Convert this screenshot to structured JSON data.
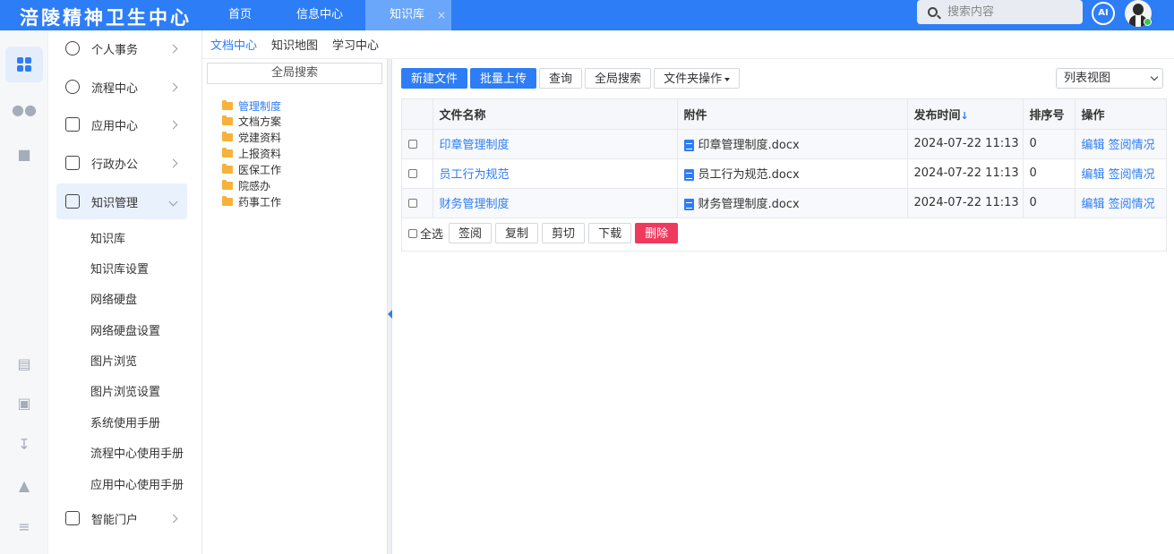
{
  "app": {
    "title": "涪陵精神卫生中心",
    "colors": {
      "primary": "#2d7df6",
      "danger": "#ef3a5d",
      "folder": "#f6b23a"
    }
  },
  "topnav": {
    "tabs": [
      {
        "label": "首页"
      },
      {
        "label": "信息中心"
      },
      {
        "label": "知识库",
        "active": true,
        "close": "×"
      }
    ]
  },
  "search": {
    "placeholder": "搜索内容"
  },
  "ai": {
    "label": "AI"
  },
  "rail": {
    "icons": [
      "apps-icon",
      "contacts-icon",
      "chat-icon",
      "chart-icon",
      "clipboard-icon",
      "download-icon",
      "shirt-icon",
      "collapse-icon"
    ]
  },
  "sidebar": {
    "items": [
      {
        "label": "个人事务",
        "icon": "person-icon"
      },
      {
        "label": "流程中心",
        "icon": "workflow-icon"
      },
      {
        "label": "应用中心",
        "icon": "bag-icon"
      },
      {
        "label": "行政办公",
        "icon": "briefcase-icon"
      },
      {
        "label": "知识管理",
        "icon": "book-icon",
        "active": true
      },
      {
        "label": "智能门户",
        "icon": "layout-icon"
      }
    ],
    "sub_items": [
      "知识库",
      "知识库设置",
      "网络硬盘",
      "网络硬盘设置",
      "图片浏览",
      "图片浏览设置",
      "系统使用手册",
      "流程中心使用手册",
      "应用中心使用手册"
    ]
  },
  "content_tabs": [
    {
      "label": "文档中心",
      "active": true
    },
    {
      "label": "知识地图"
    },
    {
      "label": "学习中心"
    }
  ],
  "tree": {
    "search_label": "全局搜索",
    "nodes": [
      "管理制度",
      "文档方案",
      "党建资料",
      "上报资料",
      "医保工作",
      "院感办",
      "药事工作"
    ]
  },
  "toolbar": {
    "new_file": "新建文件",
    "batch_upload": "批量上传",
    "query": "查询",
    "global_search": "全局搜索",
    "folder_ops": "文件夹操作"
  },
  "view_select": {
    "value": "列表视图"
  },
  "table": {
    "headers": [
      "文件名称",
      "附件",
      "发布时间",
      "排序号",
      "操作"
    ],
    "sort_indicator": "↓",
    "rows": [
      {
        "name": "印章管理制度",
        "attachment": "印章管理制度.docx",
        "time": "2024-07-22 11:13",
        "order": "0",
        "edit": "编辑",
        "sign_status": "签阅情况"
      },
      {
        "name": "员工行为规范",
        "attachment": "员工行为规范.docx",
        "time": "2024-07-22 11:13",
        "order": "0",
        "edit": "编辑",
        "sign_status": "签阅情况"
      },
      {
        "name": "财务管理制度",
        "attachment": "财务管理制度.docx",
        "time": "2024-07-22 11:13",
        "order": "0",
        "edit": "编辑",
        "sign_status": "签阅情况"
      }
    ]
  },
  "bottom_bar": {
    "select_all": "全选",
    "sign": "签阅",
    "copy": "复制",
    "cut": "剪切",
    "download": "下载",
    "delete": "删除"
  }
}
